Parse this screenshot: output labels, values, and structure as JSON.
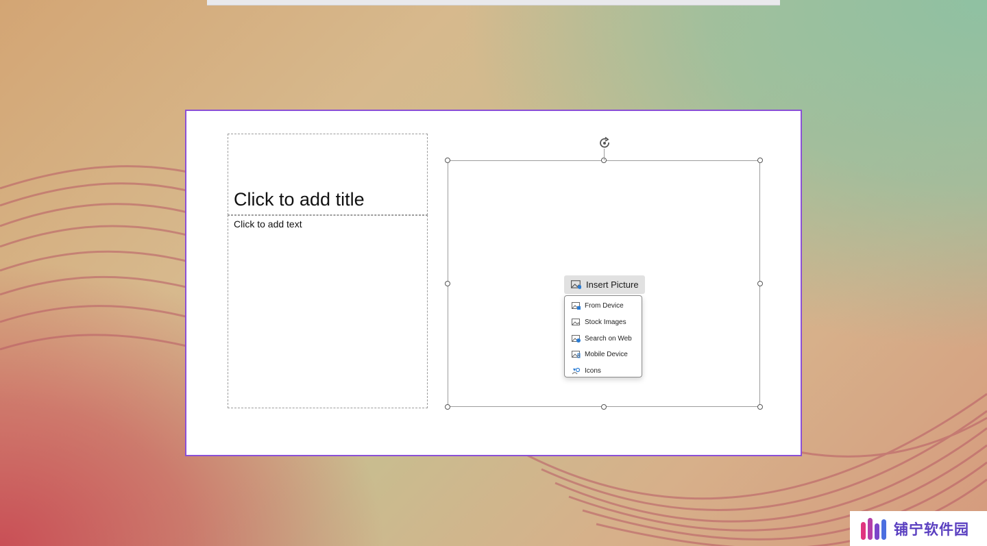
{
  "slide": {
    "title_placeholder": "Click to add title",
    "text_placeholder": "Click to add text"
  },
  "picture_placeholder": {
    "insert_label": "Insert Picture",
    "menu": [
      {
        "label": "From Device",
        "icon": "from-device-icon"
      },
      {
        "label": "Stock Images",
        "icon": "stock-images-icon"
      },
      {
        "label": "Search on Web",
        "icon": "search-on-web-icon"
      },
      {
        "label": "Mobile Device",
        "icon": "mobile-device-icon"
      },
      {
        "label": "Icons",
        "icon": "icons-icon"
      }
    ]
  },
  "watermark": {
    "text": "铺宁软件园"
  },
  "colors": {
    "selection_border": "#8a4fd6",
    "wave": "#b85a66",
    "watermark": "#5a3fc0"
  }
}
